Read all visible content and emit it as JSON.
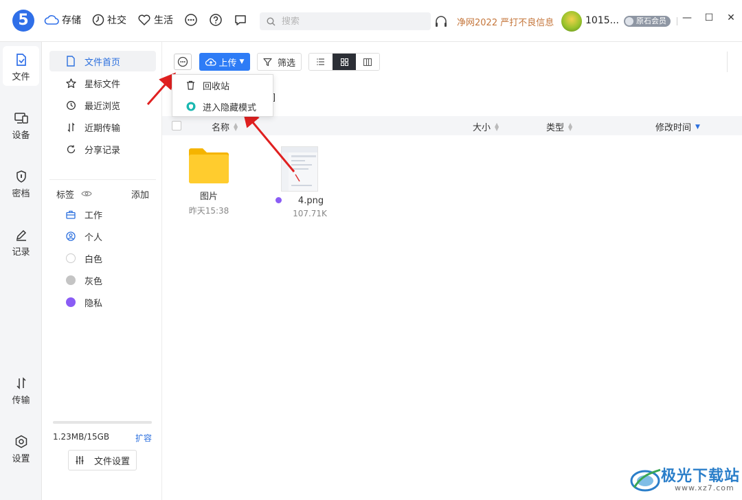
{
  "topbar": {
    "logo_text": "5",
    "nav": [
      {
        "label": "存储",
        "icon": "cloud-icon"
      },
      {
        "label": "社交",
        "icon": "clock-icon"
      },
      {
        "label": "生活",
        "icon": "heart-icon"
      }
    ],
    "icons": [
      "more-circle-icon",
      "help-circle-icon",
      "chat-bubble-icon"
    ],
    "search_placeholder": "搜索",
    "promo": "净网2022 严打不良信息",
    "username": "1015...",
    "vip": "原石会员",
    "window": {
      "minimize": "—",
      "maximize": "☐",
      "close": "✕"
    }
  },
  "rail": {
    "items": [
      {
        "label": "文件",
        "icon": "file-icon",
        "active": true
      },
      {
        "label": "设备",
        "icon": "device-icon"
      },
      {
        "label": "密档",
        "icon": "shield-icon"
      },
      {
        "label": "记录",
        "icon": "pen-icon"
      },
      {
        "label": "传输",
        "icon": "transfer-icon"
      },
      {
        "label": "设置",
        "icon": "settings-icon"
      }
    ]
  },
  "sidebar": {
    "items": [
      {
        "label": "文件首页",
        "icon": "file-icon",
        "active": true
      },
      {
        "label": "星标文件",
        "icon": "star-icon"
      },
      {
        "label": "最近浏览",
        "icon": "history-icon"
      },
      {
        "label": "近期传输",
        "icon": "transfer-icon"
      },
      {
        "label": "分享记录",
        "icon": "share-icon"
      }
    ],
    "tags_title": "标签",
    "tags_add": "添加",
    "tags": [
      {
        "label": "工作",
        "icon": "briefcase-icon"
      },
      {
        "label": "个人",
        "icon": "person-icon"
      },
      {
        "label": "白色",
        "color": "#ffffff"
      },
      {
        "label": "灰色",
        "color": "#c4c4c4"
      },
      {
        "label": "隐私",
        "color": "#8a5cf5"
      }
    ],
    "storage_text": "1.23MB/15GB",
    "expand_label": "扩容",
    "file_settings_label": "文件设置"
  },
  "toolbar": {
    "upload_label": "上传",
    "filter_label": "筛选"
  },
  "dropdown": {
    "items": [
      {
        "label": "回收站",
        "icon": "trash-icon"
      },
      {
        "label": "进入隐藏模式",
        "icon": "hidden-mode-icon"
      }
    ]
  },
  "table": {
    "columns": [
      "名称",
      "大小",
      "类型",
      "修改时间"
    ]
  },
  "files": [
    {
      "name": "图片",
      "meta": "昨天15:38",
      "type": "folder"
    },
    {
      "name": "4.png",
      "meta": "107.71K",
      "type": "image",
      "tag_color": "#8a5cf5"
    }
  ],
  "watermark": {
    "text": "极光下载站",
    "url": "www.xz7.com"
  }
}
